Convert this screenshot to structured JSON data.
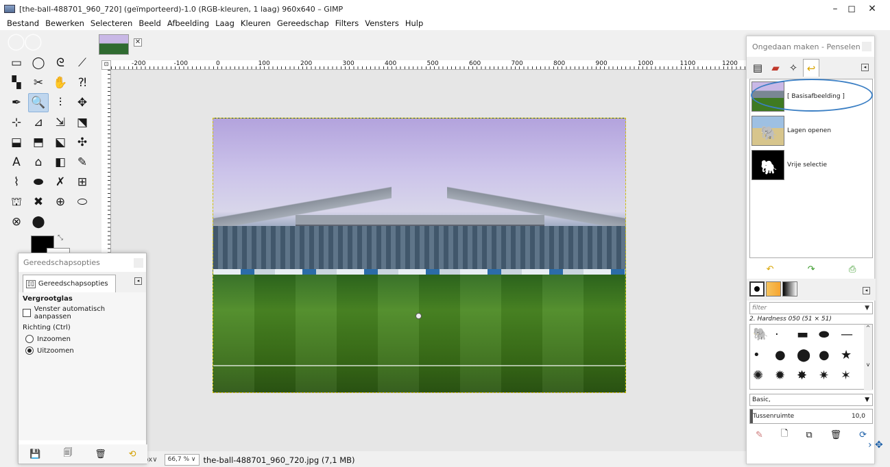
{
  "window": {
    "title": "[the-ball-488701_960_720] (geïmporteerd)-1.0 (RGB-kleuren, 1 laag) 960x640 – GIMP",
    "minimize": "–",
    "maximize": "◻",
    "close": "✕"
  },
  "menubar": [
    "Bestand",
    "Bewerken",
    "Selecteren",
    "Beeld",
    "Afbeelding",
    "Laag",
    "Kleuren",
    "Gereedschap",
    "Filters",
    "Vensters",
    "Hulp"
  ],
  "image_tab": {
    "close": "✕"
  },
  "ruler": {
    "corner": "⊡",
    "ticks": [
      "-200",
      "-100",
      "0",
      "100",
      "200",
      "300",
      "400",
      "500",
      "600",
      "700",
      "800",
      "900",
      "1000",
      "1100",
      "1200"
    ]
  },
  "toolbox": {
    "tools": [
      "▭",
      "◯",
      "ᘓ",
      "⟋",
      "▚",
      "✂",
      "✋",
      "⁈",
      "✒",
      "🔍",
      "⫶",
      "✥",
      "⊹",
      "⊿",
      "⇲",
      "⬔",
      "⬓",
      "⬒",
      "⬕",
      "✣",
      "A",
      "⌂",
      "◧",
      "✎",
      "⌇",
      "⬬",
      "✗",
      "⊞",
      "⛫",
      "✖",
      "⊕",
      "⬭",
      "⊗",
      "⬤"
    ],
    "selected_index": 9,
    "colors": {
      "fg": "#000000",
      "bg": "#ffffff"
    }
  },
  "tool_options": {
    "header": "Gereedschapsopties",
    "tab_label": "Gereedschapsopties",
    "tab_icon": "▯▯",
    "tab_menu_icon": "◂",
    "tool_name": "Vergrootglas",
    "checkbox_label": "Venster automatisch aanpassen",
    "checkbox_checked": false,
    "direction_label": "Richting  (Ctrl)",
    "radios": [
      {
        "label": "Inzoomen",
        "checked": false
      },
      {
        "label": "Uitzoomen",
        "checked": true
      }
    ],
    "footer_icons": [
      "💾",
      "🗐",
      "🗑",
      "⟲"
    ]
  },
  "statusbar": {
    "unit": "px∨",
    "zoom": "66,7 % ∨",
    "file": "the-ball-488701_960_720.jpg (7,1 MB)"
  },
  "dock": {
    "header": "Ongedaan maken - Penselen",
    "tab_icons": [
      "▤",
      "▰",
      "✧",
      "↩"
    ],
    "tab_menu_icon": "◂",
    "history": [
      {
        "label": "[ Basisafbeelding ]"
      },
      {
        "label": "Lagen openen"
      },
      {
        "label": "Vrije selectie"
      }
    ],
    "history_actions": [
      "↶",
      "↷",
      "⎙"
    ],
    "filter_placeholder": "filter",
    "brush_name": "2. Hardness 050 (51 × 51)",
    "brush_set": "Basic,",
    "spacing_label": "Tussenruimte",
    "spacing_value": "10,0",
    "dropdown_arrow": "▼",
    "footer_icons": [
      "✎",
      "🗋",
      "⧉",
      "🗑",
      "⟳"
    ],
    "brushes": [
      "🐘",
      "·",
      "▬",
      "⬬",
      "—",
      "•",
      "●",
      "⬤",
      "●",
      "★",
      "✺",
      "✹",
      "✸",
      "✷",
      "✶"
    ]
  },
  "nav": {
    "icon": "› ✥"
  }
}
